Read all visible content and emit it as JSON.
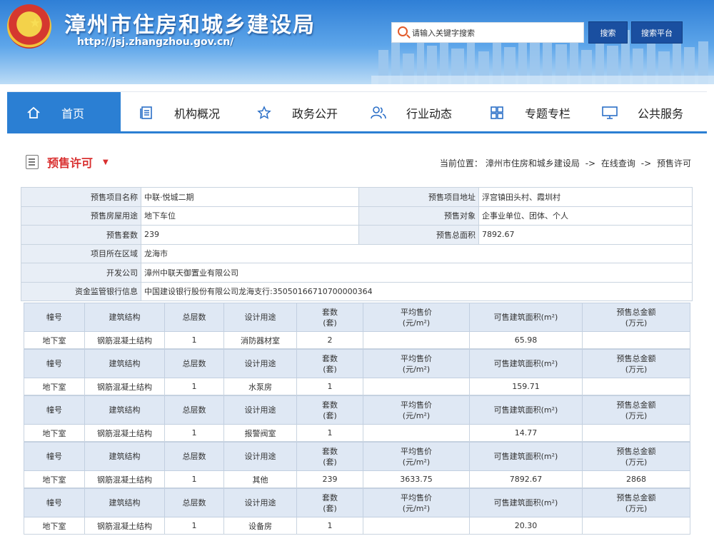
{
  "header": {
    "title": "漳州市住房和城乡建设局",
    "url": "http://jsj.zhangzhou.gov.cn/",
    "search_placeholder": "请输入关键字搜索",
    "search_button": "搜索",
    "platform_button": "搜索平台"
  },
  "nav": [
    {
      "label": "首页",
      "icon": "home-icon",
      "active": true
    },
    {
      "label": "机构概况",
      "icon": "document-list-icon"
    },
    {
      "label": "政务公开",
      "icon": "star-icon"
    },
    {
      "label": "行业动态",
      "icon": "people-icon"
    },
    {
      "label": "专题专栏",
      "icon": "grid-icon"
    },
    {
      "label": "公共服务",
      "icon": "monitor-icon"
    }
  ],
  "page": {
    "title": "预售许可",
    "breadcrumb_prefix": "当前位置：",
    "breadcrumb": [
      "漳州市住房和城乡建设局",
      "->",
      "在线查询",
      "->",
      "预售许可"
    ]
  },
  "info": {
    "project_name_label": "预售项目名称",
    "project_name": "中联·悦城二期",
    "project_address_label": "预售项目地址",
    "project_address": "浮宫镇田头村、霞圳村",
    "usage_label": "预售房屋用途",
    "usage": "地下车位",
    "target_label": "预售对象",
    "target": "企事业单位、团体、个人",
    "units_label": "预售套数",
    "units": "239",
    "total_area_label": "预售总面积",
    "total_area": "7892.67",
    "district_label": "项目所在区域",
    "district": "龙海市",
    "developer_label": "开发公司",
    "developer": "漳州中联天御置业有限公司",
    "bank_label": "资金监管银行信息",
    "bank": "中国建设银行股份有限公司龙海支行:35050166710700000364"
  },
  "unit_headers": {
    "building": "幢号",
    "structure": "建筑结构",
    "floors": "总层数",
    "design_use": "设计用途",
    "sets_1": "套数",
    "sets_2": "(套)",
    "avg_price_1": "平均售价",
    "avg_price_2": "(元/m²)",
    "area": "可售建筑面积(m²)",
    "total_amount_1": "预售总金额",
    "total_amount_2": "(万元)"
  },
  "units": [
    {
      "building": "地下室",
      "structure": "钢筋混凝土结构",
      "floors": "1",
      "design_use": "消防器材室",
      "sets": "2",
      "avg_price": "",
      "area": "65.98",
      "total_amount": ""
    },
    {
      "building": "地下室",
      "structure": "钢筋混凝土结构",
      "floors": "1",
      "design_use": "水泵房",
      "sets": "1",
      "avg_price": "",
      "area": "159.71",
      "total_amount": ""
    },
    {
      "building": "地下室",
      "structure": "钢筋混凝土结构",
      "floors": "1",
      "design_use": "报警阀室",
      "sets": "1",
      "avg_price": "",
      "area": "14.77",
      "total_amount": ""
    },
    {
      "building": "地下室",
      "structure": "钢筋混凝土结构",
      "floors": "1",
      "design_use": "其他",
      "sets": "239",
      "avg_price": "3633.75",
      "area": "7892.67",
      "total_amount": "2868"
    },
    {
      "building": "地下室",
      "structure": "钢筋混凝土结构",
      "floors": "1",
      "design_use": "设备房",
      "sets": "1",
      "avg_price": "",
      "area": "20.30",
      "total_amount": ""
    }
  ]
}
